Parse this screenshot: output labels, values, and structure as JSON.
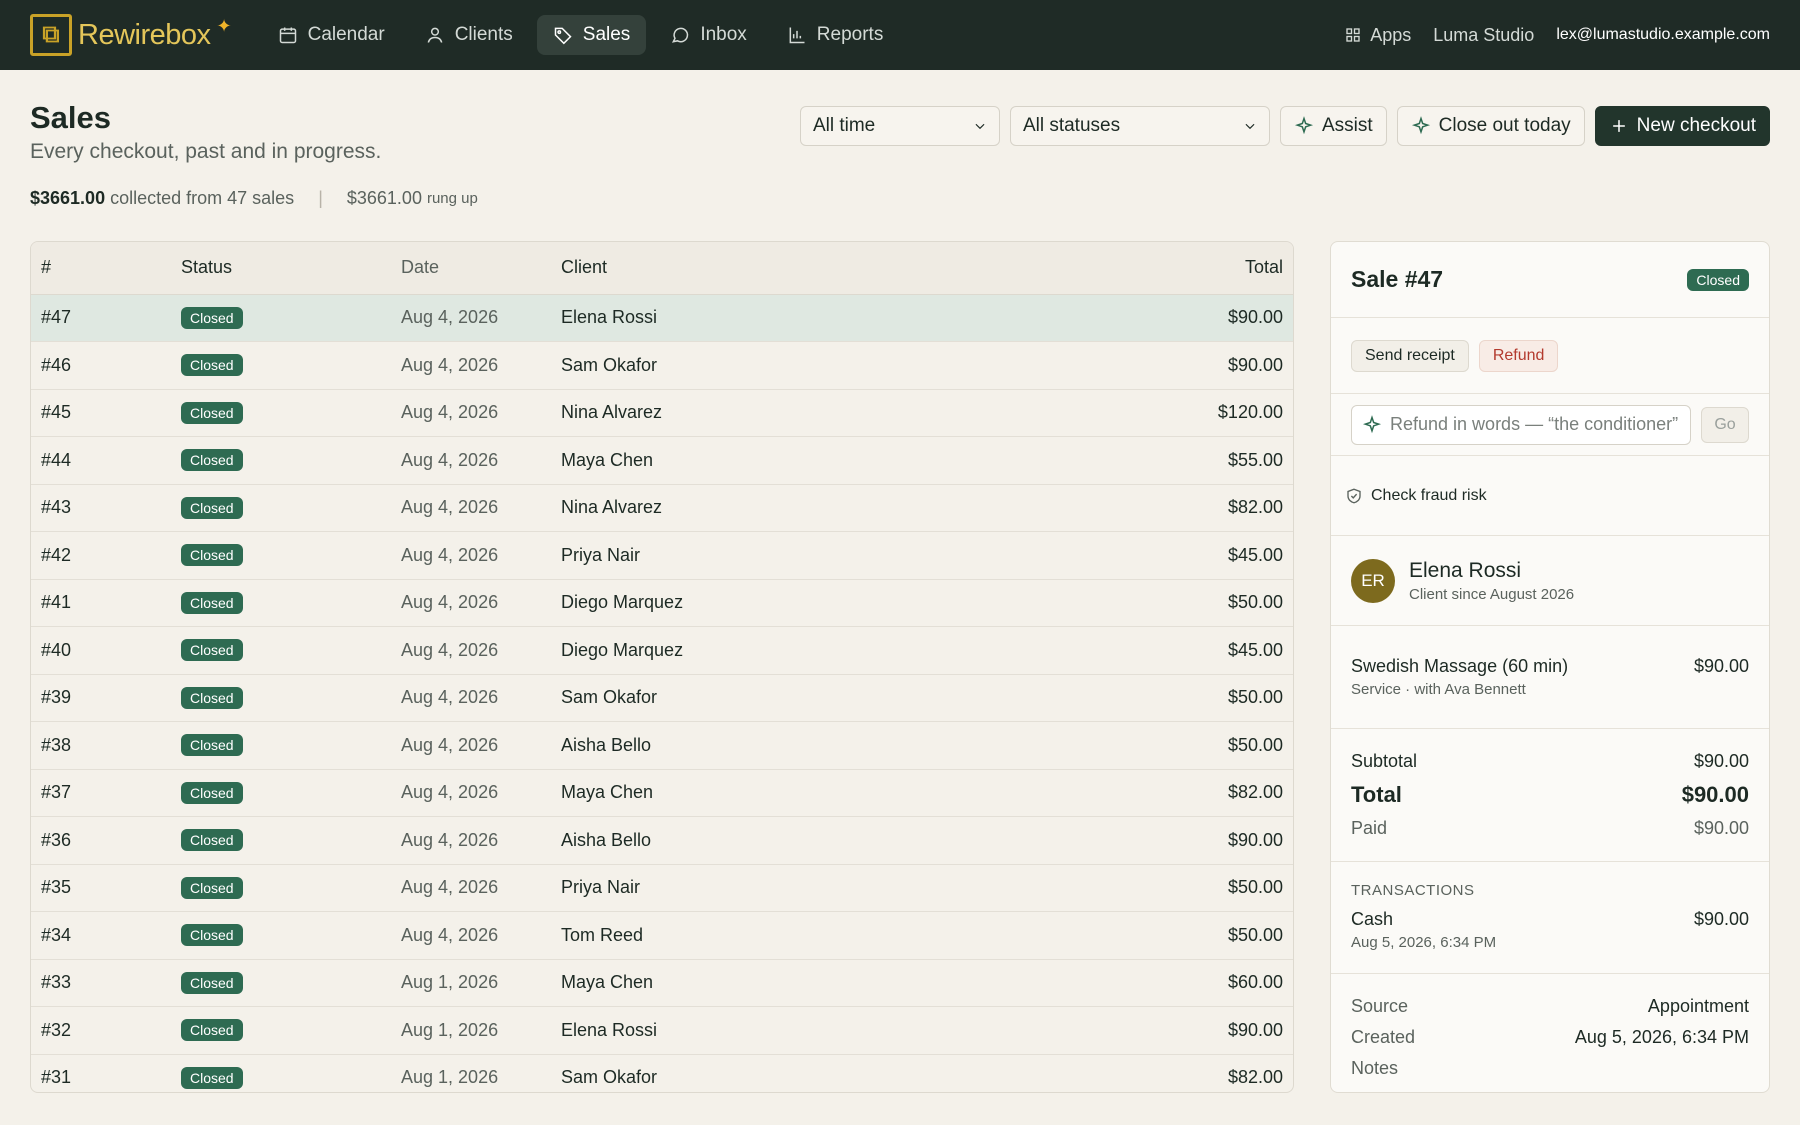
{
  "nav": {
    "brand": "Rewirebox",
    "items": [
      {
        "label": "Calendar",
        "icon": "calendar-icon"
      },
      {
        "label": "Clients",
        "icon": "user-icon"
      },
      {
        "label": "Sales",
        "icon": "tag-icon"
      },
      {
        "label": "Inbox",
        "icon": "chat-icon"
      },
      {
        "label": "Reports",
        "icon": "bar-chart-icon"
      }
    ],
    "active": "Sales",
    "apps_label": "Apps",
    "workspace": "Luma Studio",
    "email": "lex@lumastudio.example.com"
  },
  "header": {
    "title": "Sales",
    "subtitle": "Every checkout, past and in progress.",
    "time_filter": "All time",
    "status_filter": "All statuses",
    "assist_label": "Assist",
    "close_out_label": "Close out today",
    "new_checkout_label": "New checkout"
  },
  "summary": {
    "collected_amount": "$3661.00",
    "collected_text": "collected from 47 sales",
    "rung_amount": "$3661.00",
    "rung_text": "rung up"
  },
  "table": {
    "columns": [
      "#",
      "Status",
      "Date",
      "Client",
      "Total"
    ],
    "rows": [
      {
        "num": "#47",
        "status": "Closed",
        "date": "Aug 4, 2026",
        "client": "Elena Rossi",
        "total": "$90.00"
      },
      {
        "num": "#46",
        "status": "Closed",
        "date": "Aug 4, 2026",
        "client": "Sam Okafor",
        "total": "$90.00"
      },
      {
        "num": "#45",
        "status": "Closed",
        "date": "Aug 4, 2026",
        "client": "Nina Alvarez",
        "total": "$120.00"
      },
      {
        "num": "#44",
        "status": "Closed",
        "date": "Aug 4, 2026",
        "client": "Maya Chen",
        "total": "$55.00"
      },
      {
        "num": "#43",
        "status": "Closed",
        "date": "Aug 4, 2026",
        "client": "Nina Alvarez",
        "total": "$82.00"
      },
      {
        "num": "#42",
        "status": "Closed",
        "date": "Aug 4, 2026",
        "client": "Priya Nair",
        "total": "$45.00"
      },
      {
        "num": "#41",
        "status": "Closed",
        "date": "Aug 4, 2026",
        "client": "Diego Marquez",
        "total": "$50.00"
      },
      {
        "num": "#40",
        "status": "Closed",
        "date": "Aug 4, 2026",
        "client": "Diego Marquez",
        "total": "$45.00"
      },
      {
        "num": "#39",
        "status": "Closed",
        "date": "Aug 4, 2026",
        "client": "Sam Okafor",
        "total": "$50.00"
      },
      {
        "num": "#38",
        "status": "Closed",
        "date": "Aug 4, 2026",
        "client": "Aisha Bello",
        "total": "$50.00"
      },
      {
        "num": "#37",
        "status": "Closed",
        "date": "Aug 4, 2026",
        "client": "Maya Chen",
        "total": "$82.00"
      },
      {
        "num": "#36",
        "status": "Closed",
        "date": "Aug 4, 2026",
        "client": "Aisha Bello",
        "total": "$90.00"
      },
      {
        "num": "#35",
        "status": "Closed",
        "date": "Aug 4, 2026",
        "client": "Priya Nair",
        "total": "$50.00"
      },
      {
        "num": "#34",
        "status": "Closed",
        "date": "Aug 4, 2026",
        "client": "Tom Reed",
        "total": "$50.00"
      },
      {
        "num": "#33",
        "status": "Closed",
        "date": "Aug 1, 2026",
        "client": "Maya Chen",
        "total": "$60.00"
      },
      {
        "num": "#32",
        "status": "Closed",
        "date": "Aug 1, 2026",
        "client": "Elena Rossi",
        "total": "$90.00"
      },
      {
        "num": "#31",
        "status": "Closed",
        "date": "Aug 1, 2026",
        "client": "Sam Okafor",
        "total": "$82.00"
      }
    ]
  },
  "panel": {
    "title": "Sale #47",
    "status": "Closed",
    "send_receipt": "Send receipt",
    "refund": "Refund",
    "refund_placeholder": "Refund in words — “the conditioner”",
    "go": "Go",
    "fraud_label": "Check fraud risk",
    "client_initials": "ER",
    "client_name": "Elena Rossi",
    "client_since": "Client since August 2026",
    "item_name": "Swedish Massage (60 min)",
    "item_sub": "Service · with Ava Bennett",
    "item_price": "$90.00",
    "subtotal_label": "Subtotal",
    "subtotal": "$90.00",
    "total_label": "Total",
    "total": "$90.00",
    "paid_label": "Paid",
    "paid": "$90.00",
    "transactions_label": "TRANSACTIONS",
    "tx_method": "Cash",
    "tx_date": "Aug 5, 2026, 6:34 PM",
    "tx_amount": "$90.00",
    "source_label": "Source",
    "source": "Appointment",
    "created_label": "Created",
    "created": "Aug 5, 2026, 6:34 PM",
    "notes_label": "Notes"
  },
  "colors": {
    "nav_bg": "#1f2b26",
    "accent": "#2e6b52",
    "brand": "#e4c65a"
  }
}
